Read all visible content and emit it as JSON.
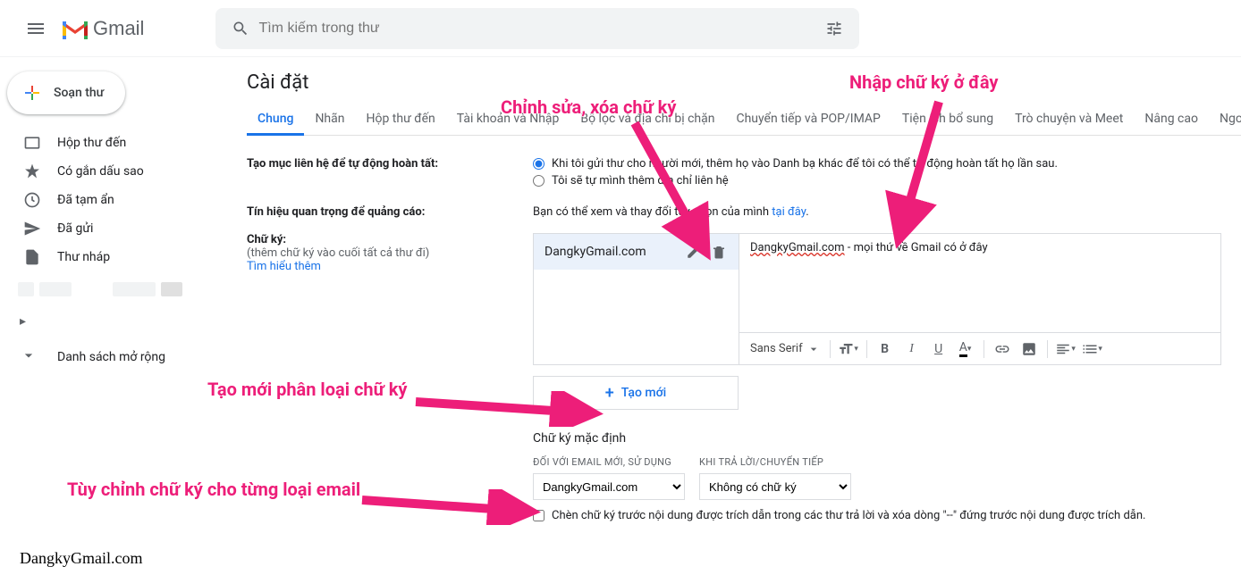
{
  "header": {
    "brand": "Gmail",
    "search_placeholder": "Tìm kiếm trong thư"
  },
  "sidebar": {
    "compose": "Soạn thư",
    "items": [
      {
        "label": "Hộp thư đến"
      },
      {
        "label": "Có gắn dấu sao"
      },
      {
        "label": "Đã tạm ẩn"
      },
      {
        "label": "Đã gửi"
      },
      {
        "label": "Thư nháp"
      }
    ],
    "expand": "Danh sách mở rộng"
  },
  "main": {
    "title": "Cài đặt",
    "tabs": [
      {
        "label": "Chung",
        "active": true
      },
      {
        "label": "Nhãn"
      },
      {
        "label": "Hộp thư đến"
      },
      {
        "label": "Tài khoản và Nhập"
      },
      {
        "label": "Bộ lọc và địa chỉ bị chặn"
      },
      {
        "label": "Chuyển tiếp và POP/IMAP"
      },
      {
        "label": "Tiện ích bổ sung"
      },
      {
        "label": "Trò chuyện và Meet"
      },
      {
        "label": "Nâng cao"
      },
      {
        "label": "Ngoại"
      }
    ],
    "contacts_create": {
      "label": "Tạo mục liên hệ để tự động hoàn tất:",
      "radio1": "Khi tôi gửi thư cho người mới, thêm họ vào Danh bạ khác để tôi có thể tự động hoàn tất họ lần sau.",
      "radio2": "Tôi sẽ tự mình thêm địa chỉ liên hệ"
    },
    "ad_signals": {
      "label": "Tín hiệu quan trọng để quảng cáo:",
      "text_prefix": "Bạn có thể xem và thay đổi tùy chọn của mình ",
      "link": "tại đây",
      "text_suffix": "."
    },
    "signature": {
      "label": "Chữ ký:",
      "sublabel": "(thêm chữ ký vào cuối tất cả thư đi)",
      "learn_more": "Tìm hiểu thêm",
      "sig_name": "DangkyGmail.com",
      "sig_content_link": "DangkyGmail.com",
      "sig_content_rest": " - mọi thứ về Gmail có ở đây",
      "font_name": "Sans Serif",
      "create_new": "Tạo mới",
      "defaults_title": "Chữ ký mặc định",
      "for_new": "ĐỐI VỚI EMAIL MỚI, SỬ DỤNG",
      "for_reply": "KHI TRẢ LỜI/CHUYỂN TIẾP",
      "select_new": "DangkyGmail.com",
      "select_reply": "Không có chữ ký",
      "checkbox_text": "Chèn chữ ký trước nội dung được trích dẫn trong các thư trả lời và xóa dòng \"--\" đứng trước nội dung được trích dẫn."
    }
  },
  "annotations": {
    "edit_delete": "Chỉnh sửa, xóa chữ ký",
    "enter_sig": "Nhập chữ ký ở đây",
    "create_category": "Tạo mới phân loại chữ ký",
    "customize_type": "Tùy chỉnh chữ ký cho từng loại email"
  },
  "watermark": "DangkyGmail.com"
}
